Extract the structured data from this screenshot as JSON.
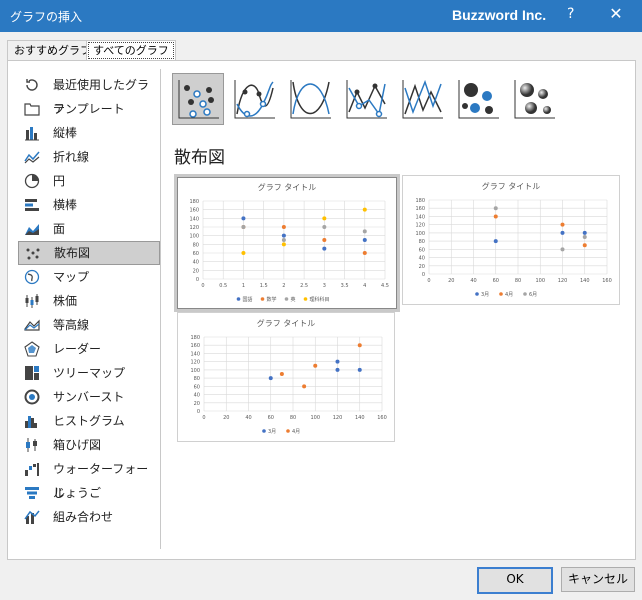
{
  "window": {
    "title": "グラフの挿入",
    "brand": "Buzzword Inc.",
    "help": "?",
    "close": "✕"
  },
  "tabs": [
    {
      "label": "おすすめグラフ"
    },
    {
      "label": "すべてのグラフ"
    }
  ],
  "sidebar": {
    "items": [
      {
        "label": "最近使用したグラフ",
        "icon": "recent-icon"
      },
      {
        "label": "テンプレート",
        "icon": "folder-icon"
      },
      {
        "label": "縦棒",
        "icon": "column-chart-icon"
      },
      {
        "label": "折れ線",
        "icon": "line-chart-icon"
      },
      {
        "label": "円",
        "icon": "pie-chart-icon"
      },
      {
        "label": "横棒",
        "icon": "bar-chart-icon"
      },
      {
        "label": "面",
        "icon": "area-chart-icon"
      },
      {
        "label": "散布図",
        "icon": "scatter-chart-icon"
      },
      {
        "label": "マップ",
        "icon": "map-chart-icon"
      },
      {
        "label": "株価",
        "icon": "stock-chart-icon"
      },
      {
        "label": "等高線",
        "icon": "surface-chart-icon"
      },
      {
        "label": "レーダー",
        "icon": "radar-chart-icon"
      },
      {
        "label": "ツリーマップ",
        "icon": "treemap-chart-icon"
      },
      {
        "label": "サンバースト",
        "icon": "sunburst-chart-icon"
      },
      {
        "label": "ヒストグラム",
        "icon": "histogram-chart-icon"
      },
      {
        "label": "箱ひげ図",
        "icon": "box-whisker-chart-icon"
      },
      {
        "label": "ウォーターフォール",
        "icon": "waterfall-chart-icon"
      },
      {
        "label": "じょうご",
        "icon": "funnel-chart-icon"
      },
      {
        "label": "組み合わせ",
        "icon": "combo-chart-icon"
      }
    ],
    "selected_index": 7
  },
  "subtypes": [
    {
      "icon": "scatter-markers-icon"
    },
    {
      "icon": "scatter-smooth-markers-icon"
    },
    {
      "icon": "scatter-smooth-icon"
    },
    {
      "icon": "scatter-straight-markers-icon"
    },
    {
      "icon": "scatter-straight-icon"
    },
    {
      "icon": "bubble-icon"
    },
    {
      "icon": "bubble-3d-icon"
    }
  ],
  "section_title": "散布図",
  "colors": {
    "blue": "#4472c4",
    "orange": "#ed7d31",
    "gray": "#a5a5a5",
    "yellow": "#ffc000",
    "accent": "#2b79c2"
  },
  "chart_data": [
    {
      "type": "scatter",
      "title": "グラフ タイトル",
      "xlim": [
        0,
        4.5
      ],
      "ylim": [
        0,
        180
      ],
      "xticks": [
        "0",
        "0.5",
        "1",
        "1.5",
        "2",
        "2.5",
        "3",
        "3.5",
        "4",
        "4.5"
      ],
      "yticks": [
        "0",
        "20",
        "40",
        "60",
        "80",
        "100",
        "120",
        "140",
        "160",
        "180"
      ],
      "series": [
        {
          "name": "国語",
          "color": "#4472c4",
          "x": [
            1,
            2,
            3,
            4
          ],
          "y": [
            140,
            100,
            70,
            90
          ]
        },
        {
          "name": "数学",
          "color": "#ed7d31",
          "x": [
            1,
            2,
            3,
            4
          ],
          "y": [
            120,
            120,
            90,
            60
          ]
        },
        {
          "name": "英",
          "color": "#a5a5a5",
          "x": [
            1,
            2,
            3,
            4
          ],
          "y": [
            120,
            90,
            120,
            110
          ]
        },
        {
          "name": "理科科目",
          "color": "#ffc000",
          "x": [
            1,
            2,
            3,
            4
          ],
          "y": [
            60,
            80,
            140,
            160
          ]
        }
      ]
    },
    {
      "type": "scatter",
      "title": "グラフ タイトル",
      "xlim": [
        0,
        160
      ],
      "ylim": [
        0,
        180
      ],
      "xticks": [
        "0",
        "20",
        "40",
        "60",
        "80",
        "100",
        "120",
        "140",
        "160"
      ],
      "yticks": [
        "0",
        "20",
        "40",
        "60",
        "80",
        "100",
        "120",
        "140",
        "160",
        "180"
      ],
      "series": [
        {
          "name": "3月",
          "color": "#4472c4",
          "x": [
            60,
            120,
            140
          ],
          "y": [
            80,
            100,
            100
          ]
        },
        {
          "name": "4月",
          "color": "#ed7d31",
          "x": [
            60,
            120,
            140
          ],
          "y": [
            140,
            120,
            70
          ]
        },
        {
          "name": "6月",
          "color": "#a5a5a5",
          "x": [
            60,
            120,
            140
          ],
          "y": [
            160,
            60,
            90
          ]
        }
      ]
    },
    {
      "type": "scatter",
      "title": "グラフ タイトル",
      "xlim": [
        0,
        160
      ],
      "ylim": [
        0,
        180
      ],
      "xticks": [
        "0",
        "20",
        "40",
        "60",
        "80",
        "100",
        "120",
        "140",
        "160"
      ],
      "yticks": [
        "0",
        "20",
        "40",
        "60",
        "80",
        "100",
        "120",
        "140",
        "160",
        "180"
      ],
      "series": [
        {
          "name": "3月",
          "color": "#4472c4",
          "x": [
            60,
            120,
            120,
            140
          ],
          "y": [
            80,
            120,
            100,
            100
          ]
        },
        {
          "name": "4月",
          "color": "#ed7d31",
          "x": [
            70,
            90,
            100,
            140
          ],
          "y": [
            90,
            60,
            110,
            160
          ]
        }
      ]
    }
  ],
  "buttons": {
    "ok": "OK",
    "cancel": "キャンセル"
  }
}
